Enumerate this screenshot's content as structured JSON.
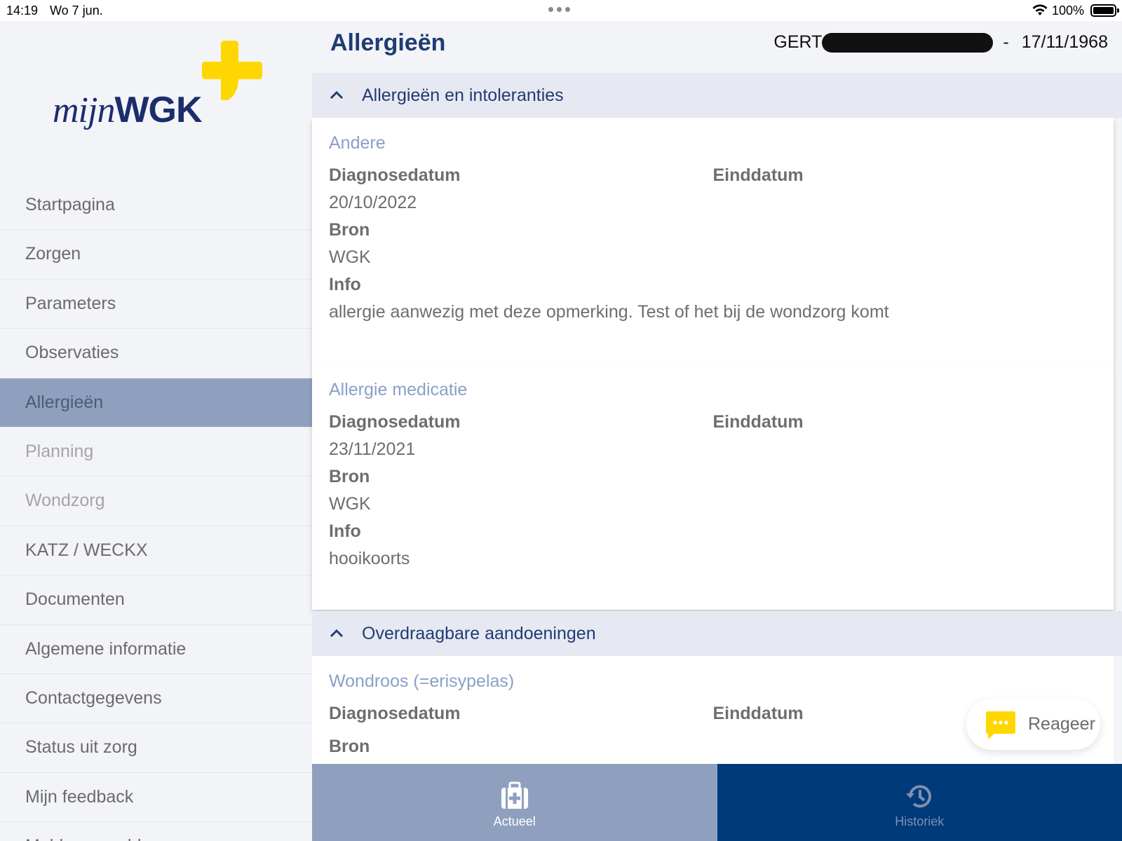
{
  "status_bar": {
    "time": "14:19",
    "date": "Wo 7 jun.",
    "battery": "100%",
    "icons": [
      "more-dots-icon",
      "wifi-icon",
      "battery-icon"
    ]
  },
  "app": {
    "logo_text_italic": "mijn",
    "logo_text_bold": "WGK",
    "brand_color": "#1c2d6b",
    "accent_color": "#ffd700"
  },
  "sidebar": {
    "items": [
      {
        "label": "Startpagina",
        "state": "normal"
      },
      {
        "label": "Zorgen",
        "state": "normal"
      },
      {
        "label": "Parameters",
        "state": "normal"
      },
      {
        "label": "Observaties",
        "state": "normal"
      },
      {
        "label": "Allergieën",
        "state": "active"
      },
      {
        "label": "Planning",
        "state": "disabled"
      },
      {
        "label": "Wondzorg",
        "state": "disabled"
      },
      {
        "label": "KATZ / WECKX",
        "state": "normal"
      },
      {
        "label": "Documenten",
        "state": "normal"
      },
      {
        "label": "Algemene informatie",
        "state": "normal"
      },
      {
        "label": "Contactgegevens",
        "state": "normal"
      },
      {
        "label": "Status uit zorg",
        "state": "normal"
      },
      {
        "label": "Mijn feedback",
        "state": "normal"
      },
      {
        "label": "Meld een probleem",
        "state": "normal"
      }
    ]
  },
  "header": {
    "title": "Allergieën",
    "patient_name_visible": "GERT",
    "patient_separator": "-",
    "patient_birthdate": "17/11/1968"
  },
  "sections": [
    {
      "title": "Allergieën en intoleranties",
      "cards": [
        {
          "title": "Andere",
          "diagnose_label": "Diagnosedatum",
          "diagnose_value": "20/10/2022",
          "end_label": "Einddatum",
          "source_label": "Bron",
          "source_value": "WGK",
          "info_label": "Info",
          "info_value": "allergie aanwezig met deze opmerking. Test of het bij de wondzorg komt"
        },
        {
          "title": "Allergie medicatie",
          "diagnose_label": "Diagnosedatum",
          "diagnose_value": "23/11/2021",
          "end_label": "Einddatum",
          "source_label": "Bron",
          "source_value": "WGK",
          "info_label": "Info",
          "info_value": "hooikoorts"
        }
      ]
    },
    {
      "title": "Overdraagbare aandoeningen",
      "cards": [
        {
          "title": "Wondroos (=erisypelas)",
          "diagnose_label": "Diagnosedatum",
          "end_label": "Einddatum",
          "source_label": "Bron"
        }
      ]
    }
  ],
  "reageer": {
    "label": "Reageer",
    "icon": "chat-bubble-icon"
  },
  "tabs": [
    {
      "label": "Actueel",
      "icon": "medical-kit-icon",
      "active": true
    },
    {
      "label": "Historiek",
      "icon": "history-icon",
      "active": false
    }
  ]
}
